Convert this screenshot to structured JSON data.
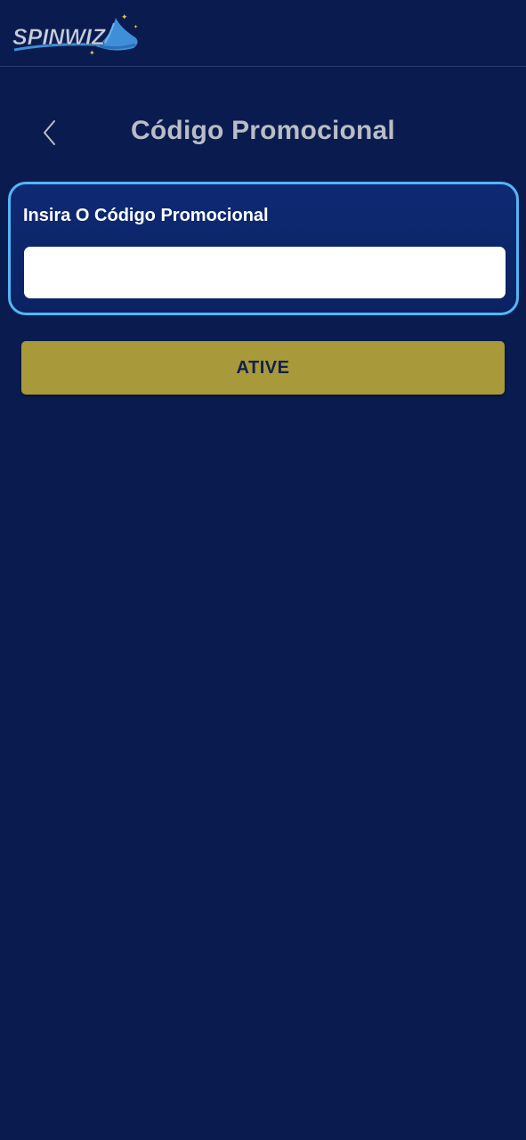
{
  "brand": {
    "logo_text": "SPINWIZ",
    "logo_icon": "wizard-hat-icon",
    "colors": {
      "background": "#0a1c4f",
      "card_border": "#54b6f4",
      "button": "#a8993a",
      "title": "#b9bdc6"
    }
  },
  "header": {
    "back_icon": "chevron-left-icon",
    "title": "Código Promocional"
  },
  "promo_form": {
    "label": "Insira O Código Promocional",
    "input_value": "",
    "input_placeholder": "",
    "submit_label": "ATIVE"
  }
}
